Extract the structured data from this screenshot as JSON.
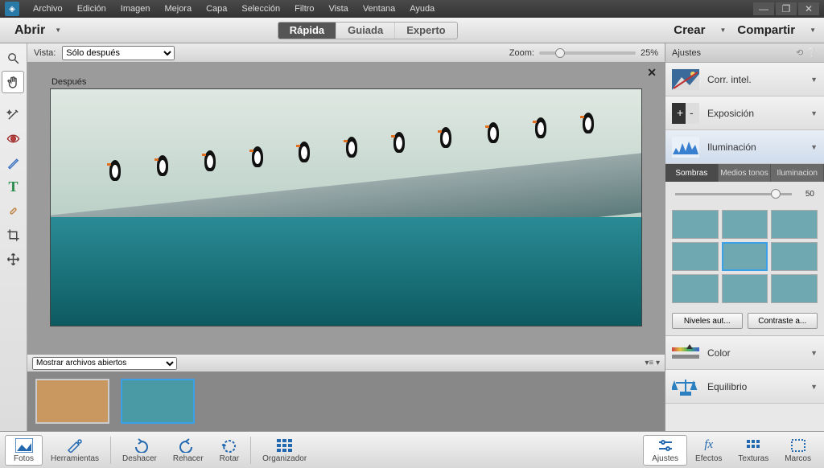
{
  "menu": {
    "items": [
      "Archivo",
      "Edición",
      "Imagen",
      "Mejora",
      "Capa",
      "Selección",
      "Filtro",
      "Vista",
      "Ventana",
      "Ayuda"
    ]
  },
  "optbar": {
    "open": "Abrir",
    "modes": {
      "quick": "Rápida",
      "guided": "Guiada",
      "expert": "Experto"
    },
    "create": "Crear",
    "share": "Compartir"
  },
  "viewbar": {
    "vista": "Vista:",
    "after_only": "Sólo después",
    "zoom": "Zoom:",
    "zoom_pct": "25%"
  },
  "canvas": {
    "after": "Después"
  },
  "filmstrip": {
    "show": "Mostrar archivos abiertos"
  },
  "rpanel": {
    "ajustes": "Ajustes",
    "items": {
      "intel": "Corr. intel.",
      "expo": "Exposición",
      "ilum": "Iluminación",
      "color": "Color",
      "equil": "Equilibrio"
    },
    "subtabs": {
      "sombras": "Sombras",
      "medios": "Medios tonos",
      "ilum": "Iluminacion"
    },
    "slider_val": "50",
    "btn_niv": "Niveles aut...",
    "btn_con": "Contraste a..."
  },
  "bottom": {
    "fotos": "Fotos",
    "herr": "Herramientas",
    "deshacer": "Deshacer",
    "rehacer": "Rehacer",
    "rotar": "Rotar",
    "org": "Organizador",
    "ajustes": "Ajustes",
    "efectos": "Efectos",
    "texturas": "Texturas",
    "marcos": "Marcos"
  }
}
